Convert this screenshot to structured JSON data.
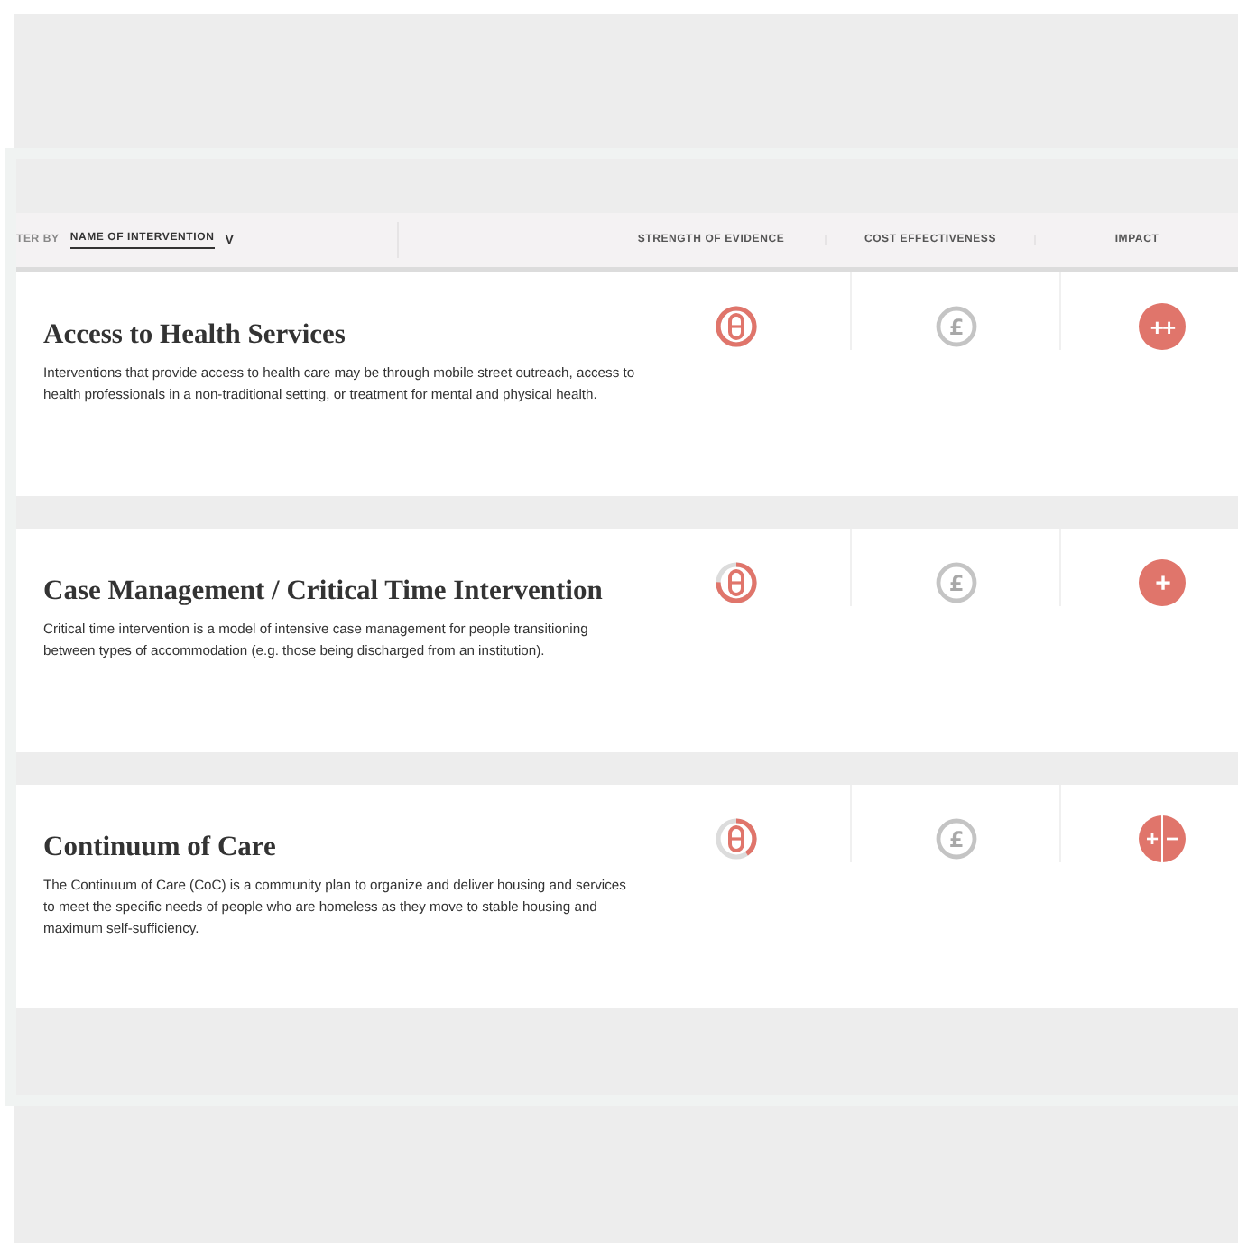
{
  "filter": {
    "prefix": "TER BY",
    "selected_option": "NAME OF INTERVENTION",
    "caret": "V"
  },
  "columns": [
    "STRENGTH OF EVIDENCE",
    "COST EFFECTIVENESS",
    "IMPACT"
  ],
  "interventions": [
    {
      "title": "Access to Health Services",
      "description": "Interventions that provide access to health care may be through mobile street outreach, access to health professionals in a non-traditional setting, or treatment for mental and physical health.",
      "evidence": {
        "level": 1
      },
      "cost": {
        "rated": false,
        "symbol": "£"
      },
      "impact": {
        "kind": "double-positive",
        "symbol": "++"
      }
    },
    {
      "title": "Case Management / Critical Time Intervention",
      "description": "Critical time intervention is a model of intensive case management for people transitioning between types of accommodation (e.g. those being discharged from an institution).",
      "evidence": {
        "level": 0.75
      },
      "cost": {
        "rated": false,
        "symbol": "£"
      },
      "impact": {
        "kind": "positive",
        "symbol": "+"
      }
    },
    {
      "title": "Continuum of Care",
      "description": "The Continuum of Care (CoC) is a community plan to organize and deliver housing and services to meet the specific needs of people who are homeless as they move to stable housing and maximum self-sufficiency.",
      "evidence": {
        "level": 0.4
      },
      "cost": {
        "rated": false,
        "symbol": "£"
      },
      "impact": {
        "kind": "mixed",
        "symbol": "+−"
      }
    }
  ]
}
